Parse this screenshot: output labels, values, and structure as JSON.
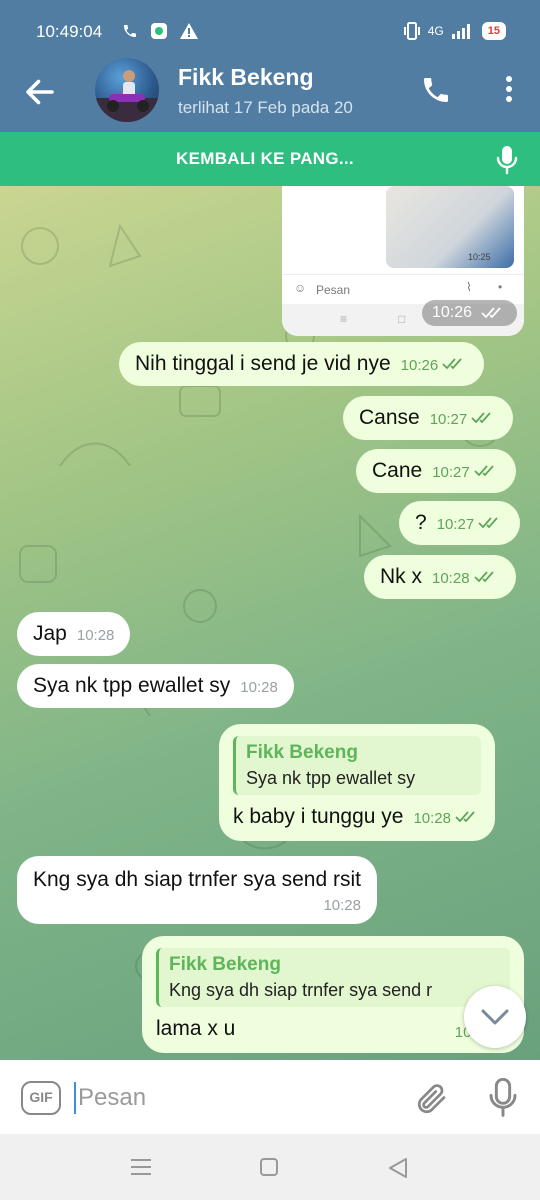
{
  "status_bar": {
    "time": "10:49:04",
    "network": "4G",
    "battery": "15"
  },
  "header": {
    "contact_name": "Fikk Bekeng",
    "last_seen": "terlihat  17 Feb pada 20"
  },
  "banner": {
    "label": "KEMBALI KE PANG..."
  },
  "forwarded_screenshot": {
    "inner_time": "10:25",
    "inner_placeholder": "Pesan",
    "time": "10:26"
  },
  "messages": [
    {
      "dir": "out",
      "text": "Nih tinggal i send je vid nye",
      "time": "10:26"
    },
    {
      "dir": "out",
      "text": "Canse",
      "time": "10:27"
    },
    {
      "dir": "out",
      "text": "Cane",
      "time": "10:27"
    },
    {
      "dir": "out",
      "text": "?",
      "time": "10:27"
    },
    {
      "dir": "out",
      "text": "Nk x",
      "time": "10:28"
    },
    {
      "dir": "in",
      "text": "Jap",
      "time": "10:28"
    },
    {
      "dir": "in",
      "text": "Sya nk tpp ewallet sy",
      "time": "10:28"
    },
    {
      "dir": "out",
      "reply_name": "Fikk Bekeng",
      "reply_text": "Sya nk tpp ewallet sy",
      "text": "k baby i tunggu ye",
      "time": "10:28"
    },
    {
      "dir": "in",
      "text": "Kng sya dh siap trnfer sya send rsit",
      "time": "10:28"
    },
    {
      "dir": "out",
      "reply_name": "Fikk Bekeng",
      "reply_text": "Kng sya dh siap trnfer sya send r",
      "text": "lama x u",
      "time": "10:2"
    }
  ],
  "composer": {
    "gif_label": "GIF",
    "placeholder": "Pesan"
  },
  "colors": {
    "header": "#517da2",
    "banner": "#2ebf80",
    "outgoing_bubble": "#effedd",
    "incoming_bubble": "#ffffff",
    "accent_green": "#5fb55a"
  }
}
